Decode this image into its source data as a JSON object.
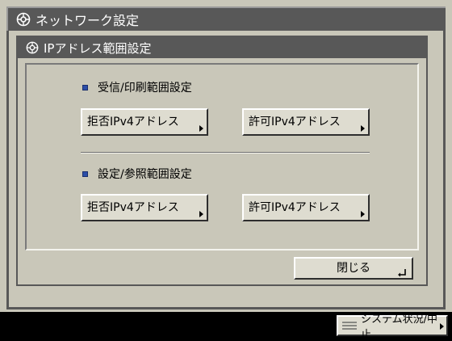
{
  "window": {
    "title": "ネットワーク設定",
    "icon": "settings-gear-icon"
  },
  "dialog": {
    "title": "IPアドレス範囲設定",
    "icon": "settings-gear-icon",
    "sections": [
      {
        "label": "受信/印刷範囲設定",
        "buttons": [
          {
            "label": "拒否IPv4アドレス"
          },
          {
            "label": "許可IPv4アドレス"
          }
        ]
      },
      {
        "label": "設定/参照範囲設定",
        "buttons": [
          {
            "label": "拒否IPv4アドレス"
          },
          {
            "label": "許可IPv4アドレス"
          }
        ]
      }
    ],
    "close_label": "閉じる"
  },
  "footer": {
    "status_label": "システム状況/中止"
  },
  "colors": {
    "background": "#c9c7b9",
    "title_bar": "#585858",
    "bullet": "#2c4ea8",
    "button_face": "#dedcd0"
  }
}
